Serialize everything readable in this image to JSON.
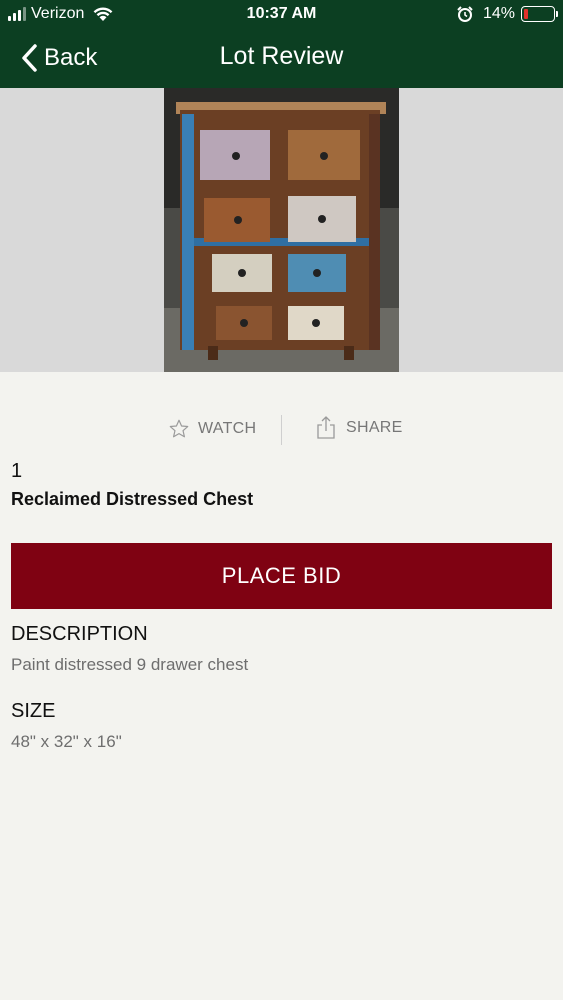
{
  "status_bar": {
    "carrier": "Verizon",
    "time": "10:37 AM",
    "battery_percent": "14%",
    "battery_level": 0.14,
    "icons": [
      "signal-icon",
      "wifi-icon",
      "alarm-icon",
      "battery-icon"
    ]
  },
  "nav": {
    "back_label": "Back",
    "title": "Lot Review",
    "back_icon": "chevron-left-icon"
  },
  "colors": {
    "header_bg": "#0c3f22",
    "bid_button_bg": "#7f0212",
    "page_bg": "#f3f3ef",
    "battery_low": "#e0302a"
  },
  "actions": {
    "watch_label": "WATCH",
    "share_label": "SHARE",
    "watch_icon": "star-outline-icon",
    "share_icon": "share-icon"
  },
  "lot": {
    "number": "1",
    "title": "Reclaimed Distressed Chest",
    "bid_label": "PLACE BID"
  },
  "description": {
    "heading": "DESCRIPTION",
    "text": "Paint distressed 9 drawer chest"
  },
  "size": {
    "heading": "SIZE",
    "text": "48\" x 32\" x 16\""
  }
}
